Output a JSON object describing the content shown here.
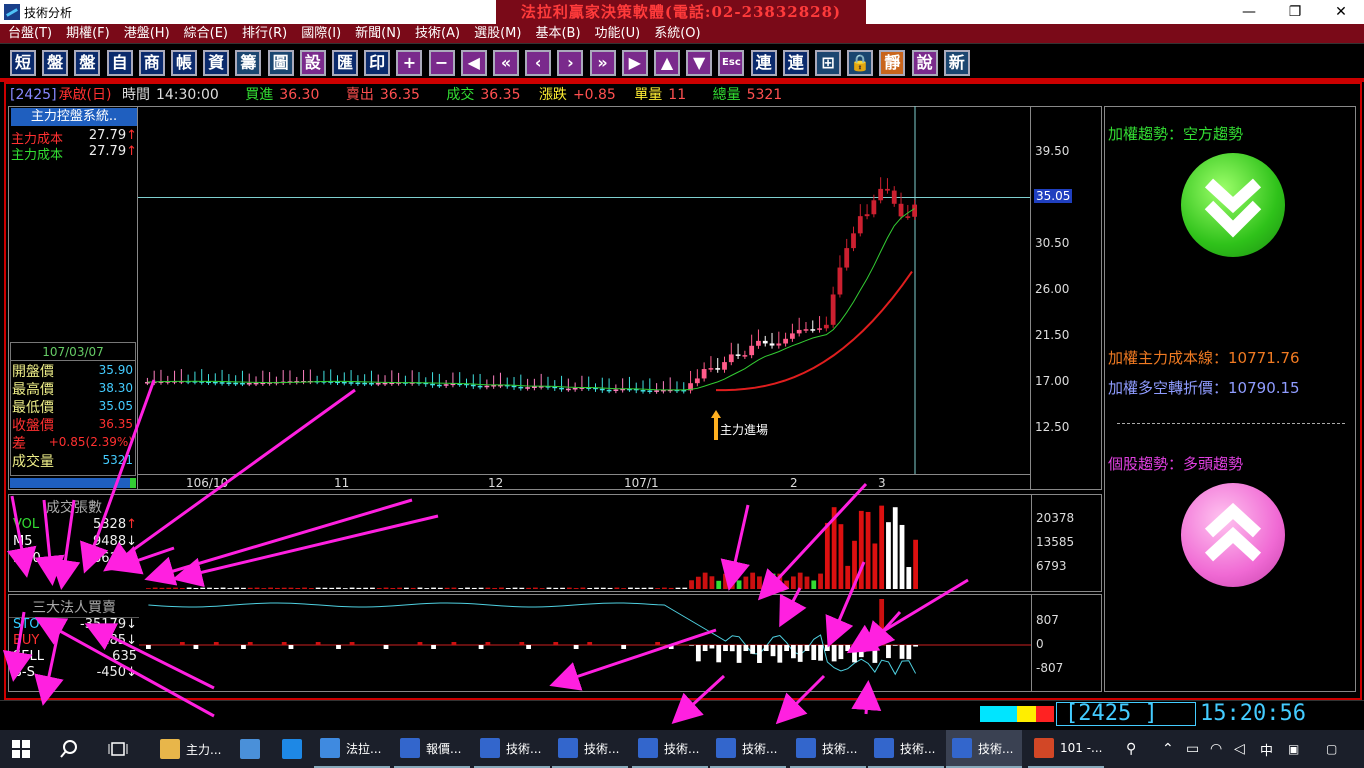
{
  "window": {
    "title": "技術分析",
    "banner": "法拉利贏家決策軟體(電話:02-23832828)",
    "minimize": "—",
    "restore": "❐",
    "close": "✕"
  },
  "menu": [
    "台盤(T)",
    "期權(F)",
    "港盤(H)",
    "綜合(E)",
    "排行(R)",
    "國際(I)",
    "新聞(N)",
    "技術(A)",
    "選股(M)",
    "基本(B)",
    "功能(U)",
    "系統(O)"
  ],
  "toolbar": {
    "buttons": [
      {
        "label": "短",
        "name": "short-term-button",
        "style": "blue"
      },
      {
        "label": "盤",
        "name": "intraday-button",
        "style": "blue"
      },
      {
        "label": "盤",
        "name": "market-button",
        "style": "blue"
      },
      {
        "label": "自",
        "name": "self-select-button",
        "style": "blue"
      },
      {
        "label": "商",
        "name": "commodity-button",
        "style": "blue"
      },
      {
        "label": "帳",
        "name": "account-button",
        "style": "blue"
      },
      {
        "label": "資",
        "name": "info-button",
        "style": "blue"
      },
      {
        "label": "籌",
        "name": "chips-button",
        "style": "dark"
      },
      {
        "label": "圖",
        "name": "chart-button",
        "style": "dark"
      },
      {
        "label": "設",
        "name": "settings-button",
        "style": "mag"
      },
      {
        "label": "匯",
        "name": "export-button",
        "style": "blue"
      },
      {
        "label": "印",
        "name": "print-button",
        "style": "blue"
      },
      {
        "label": "+",
        "name": "zoom-in-button",
        "style": "mag"
      },
      {
        "label": "−",
        "name": "zoom-out-button",
        "style": "mag"
      },
      {
        "label": "◀",
        "name": "scroll-start-button",
        "style": "mag"
      },
      {
        "label": "«",
        "name": "page-back-button",
        "style": "mag"
      },
      {
        "label": "‹",
        "name": "step-back-button",
        "style": "mag"
      },
      {
        "label": "›",
        "name": "step-forward-button",
        "style": "mag"
      },
      {
        "label": "»",
        "name": "page-forward-button",
        "style": "mag"
      },
      {
        "label": "▶",
        "name": "scroll-end-button",
        "style": "mag"
      },
      {
        "label": "▲",
        "name": "up-button",
        "style": "mag"
      },
      {
        "label": "▼",
        "name": "down-button",
        "style": "mag"
      },
      {
        "label": "Esc",
        "name": "escape-button",
        "style": "mag"
      },
      {
        "label": "連",
        "name": "connect-button",
        "style": "blue"
      },
      {
        "label": "連",
        "name": "reconnect-button",
        "style": "blue"
      },
      {
        "label": "⊞",
        "name": "window-button",
        "style": "dark"
      },
      {
        "label": "🔒",
        "name": "lock-button",
        "style": "dark"
      },
      {
        "label": "靜",
        "name": "mute-button",
        "style": "org"
      },
      {
        "label": "說",
        "name": "help-button",
        "style": "mag"
      },
      {
        "label": "新",
        "name": "news-button",
        "style": "dark"
      }
    ]
  },
  "quote": {
    "symbol": "[2425]",
    "name": "承啟(日)",
    "time_label": "時間",
    "time": "14:30:00",
    "bid_label": "買進",
    "bid": "36.30",
    "ask_label": "賣出",
    "ask": "36.35",
    "last_label": "成交",
    "last": "36.35",
    "change_label": "漲跌",
    "change": "+0.85",
    "lot_label": "單量",
    "lot": "11",
    "total_label": "總量",
    "total": "5321"
  },
  "left_panel": {
    "system_title": "主力控盤系統..",
    "rows": [
      {
        "label": "主力成本",
        "value": "27.79",
        "arrow": "↑",
        "color": "#ff3030"
      },
      {
        "label": "主力成本",
        "value": "27.79",
        "arrow": "↑",
        "color": "#33dd33"
      }
    ],
    "ohlc": {
      "date": "107/03/07",
      "rows": [
        {
          "label": "開盤價",
          "value": "35.90"
        },
        {
          "label": "最高價",
          "value": "38.30"
        },
        {
          "label": "最低價",
          "value": "35.05"
        },
        {
          "label": "收盤價",
          "value": "36.35",
          "color": "#ff3030"
        },
        {
          "label": "差",
          "value": "+0.85(2.39%)",
          "color": "#ff3030"
        },
        {
          "label": "成交量",
          "value": "5321"
        }
      ]
    }
  },
  "price_axis": {
    "labels": [
      "39.50",
      "35.05",
      "30.50",
      "26.00",
      "21.50",
      "17.00",
      "12.50"
    ],
    "cursor": "35.05"
  },
  "date_axis": [
    "106/10",
    "11",
    "12",
    "107/1",
    "2",
    "3"
  ],
  "annotation": {
    "entry_label": "主力進場"
  },
  "volume_panel": {
    "title": "成交張數",
    "rows": [
      {
        "label": "VOL",
        "value": "5328",
        "arrow": "↑",
        "color": "#33dd33"
      },
      {
        "label": "M5",
        "value": "9488",
        "arrow": "↓",
        "color": "#ffffff"
      },
      {
        "label": "M10",
        "value": "8617",
        "arrow": "↓",
        "color": "#ffffff"
      }
    ],
    "axis": [
      "20378",
      "13585",
      "6793"
    ]
  },
  "inst_panel": {
    "title": "三大法人買賣",
    "rows": [
      {
        "label": "STOCK",
        "value": "-35179",
        "arrow": "↓",
        "color": "#33ccff"
      },
      {
        "label": "BUY",
        "value": "185",
        "arrow": "↓",
        "color": "#ff3030"
      },
      {
        "label": "SELL",
        "value": "635",
        "arrow": "",
        "color": "#ffffff"
      },
      {
        "label": "B-S",
        "value": "-450",
        "arrow": "↓",
        "color": "#ffffff"
      }
    ],
    "axis": [
      "807",
      "0",
      "-807"
    ]
  },
  "right_panel": {
    "index_trend": "加權趨勢：空方趨勢",
    "cost_line_label": "加權主力成本線：",
    "cost_line_value": "10771.76",
    "pivot_label": "加權多空轉折價：",
    "pivot_value": "10790.15",
    "stock_trend": "個股趨勢：多頭趨勢"
  },
  "status": {
    "code": "[2425  ]",
    "time": "15:20:56",
    "colors": [
      "#00e5ff",
      "#00e5ff",
      "#ffee00",
      "#ff2222"
    ]
  },
  "taskbar": {
    "items": [
      {
        "label": "主力...",
        "name": "task-folder",
        "color": "#e8b64a"
      },
      {
        "label": "",
        "name": "task-computer",
        "color": "#4a90d9"
      },
      {
        "label": "",
        "name": "task-ie",
        "color": "#1e88e5"
      },
      {
        "label": "法拉...",
        "name": "task-ferrari",
        "color": "#3f8ae0"
      },
      {
        "label": "報價...",
        "name": "task-quote",
        "color": "#3366cc"
      },
      {
        "label": "技術...",
        "name": "task-tech-1",
        "color": "#3366cc"
      },
      {
        "label": "技術...",
        "name": "task-tech-2",
        "color": "#3366cc"
      },
      {
        "label": "技術...",
        "name": "task-tech-3",
        "color": "#3366cc"
      },
      {
        "label": "技術...",
        "name": "task-tech-4",
        "color": "#3366cc"
      },
      {
        "label": "技術...",
        "name": "task-tech-5",
        "color": "#3366cc"
      },
      {
        "label": "技術...",
        "name": "task-tech-6",
        "color": "#3366cc"
      },
      {
        "label": "技術...",
        "name": "task-tech-7",
        "color": "#3366cc"
      },
      {
        "label": "101 -...",
        "name": "task-powerpoint",
        "color": "#d24726"
      }
    ],
    "ime": "中",
    "tray_icons": [
      "person-icon",
      "chevron-up-icon",
      "battery-icon",
      "wifi-icon",
      "volume-icon"
    ]
  }
}
